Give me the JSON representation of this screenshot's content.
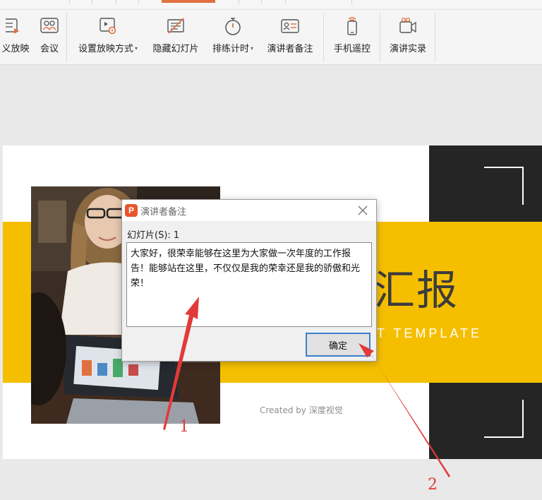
{
  "ribbon": {
    "buttons": [
      {
        "label": "义放映",
        "icon": "custom-show-icon"
      },
      {
        "label": "会议",
        "icon": "meeting-icon"
      },
      {
        "label": "设置放映方式",
        "icon": "slideshow-settings-icon",
        "dropdown": true
      },
      {
        "label": "隐藏幻灯片",
        "icon": "hide-slide-icon"
      },
      {
        "label": "排练计时",
        "icon": "stopwatch-icon",
        "dropdown": true
      },
      {
        "label": "演讲者备注",
        "icon": "speaker-notes-icon"
      },
      {
        "label": "手机遥控",
        "icon": "phone-remote-icon"
      },
      {
        "label": "演讲实录",
        "icon": "record-icon"
      }
    ],
    "active_tab_color": "#e0703f"
  },
  "slide": {
    "title_partial": "汇报",
    "subtitle_partial": "T TEMPLATE",
    "credit": "Created by 深度视觉",
    "accent_color": "#f5bf00",
    "dark_color": "#252525"
  },
  "dialog": {
    "title": "演讲者备注",
    "logo_letter": "P",
    "slide_label": "幻灯片(S): 1",
    "notes_text": "大家好，很荣幸能够在这里为大家做一次年度的工作报告！能够站在这里，不仅仅是我的荣幸还是我的骄傲和光荣！",
    "ok_label": "确定"
  },
  "annotations": {
    "marker_1": "1",
    "marker_2": "2",
    "arrow_color": "#e23a3a"
  }
}
